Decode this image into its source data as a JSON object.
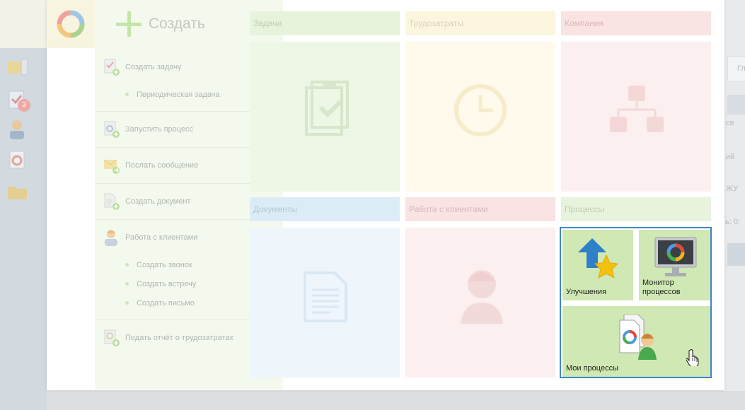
{
  "background": {
    "badge_count": "3",
    "right_snippets": [
      "Гл",
      "се",
      "ий",
      "ЖУ",
      "ь: 0;"
    ]
  },
  "create": {
    "title": "Создать"
  },
  "menu": [
    {
      "label": "Создать задачу",
      "icon": "task-add-icon",
      "subs": [
        "Периодическая задача"
      ]
    },
    {
      "label": "Запустить процесс",
      "icon": "process-add-icon",
      "subs": []
    },
    {
      "label": "Послать сообщение",
      "icon": "message-send-icon",
      "subs": []
    },
    {
      "label": "Создать документ",
      "icon": "document-add-icon",
      "subs": []
    },
    {
      "label": "Работа с клиентами",
      "icon": "client-icon",
      "subs": [
        "Создать звонок",
        "Создать встречу",
        "Создать письмо"
      ]
    },
    {
      "label": "Подать отчёт о трудозатратах",
      "icon": "timesheet-add-icon",
      "subs": []
    }
  ],
  "tiles": {
    "tasks": {
      "label": "Задачи"
    },
    "labor": {
      "label": "Трудозатраты"
    },
    "company": {
      "label": "Компания"
    },
    "documents": {
      "label": "Документы"
    },
    "clients": {
      "label": "Работа с клиентами"
    },
    "processes": {
      "label": "Процессы"
    }
  },
  "processes": {
    "improvements": "Улучшения",
    "monitor_line1": "Монитор",
    "monitor_line2": "процессов",
    "my_processes": "Мои процессы"
  },
  "colors": {
    "accent_border": "#3f86c7",
    "tasks_bg": "#eef7e6",
    "labor_bg": "#fffaec",
    "company_bg": "#fbefef",
    "documents_bg": "#eef5fb",
    "processes_cell": "#d0e8b3"
  }
}
